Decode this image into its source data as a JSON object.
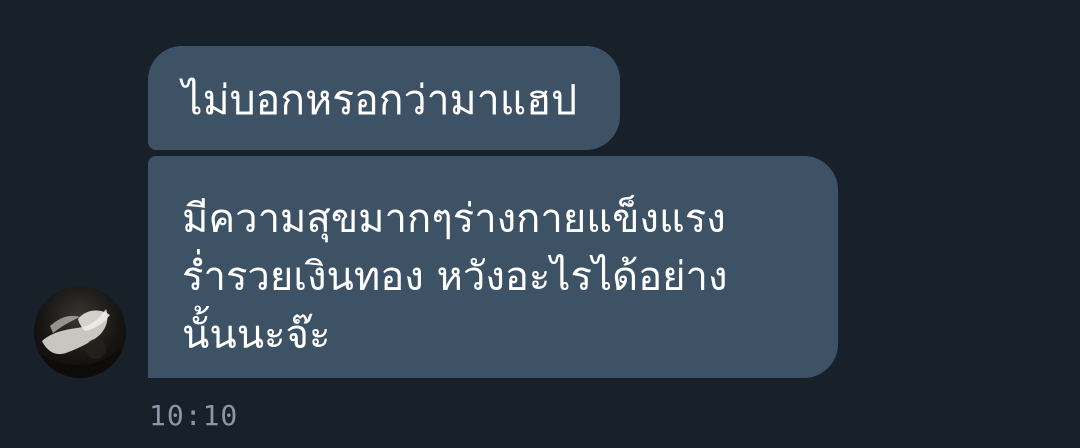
{
  "chat": {
    "messages": [
      {
        "lines": [
          "ไม่บอกหรอกว่ามาแฮป"
        ]
      },
      {
        "lines": [
          "มีความสุขมากๆร่างกายแข็งแรง",
          "ร่ำรวยเงินทอง หวังอะไรได้อย่าง",
          "นั้นนะจ๊ะ"
        ]
      }
    ],
    "timestamp": "10:10",
    "avatar_icon": "user-avatar-photo"
  },
  "colors": {
    "background": "#18202a",
    "bubble": "#3e5266",
    "text": "#ffffff",
    "timestamp": "#8b97a6"
  }
}
